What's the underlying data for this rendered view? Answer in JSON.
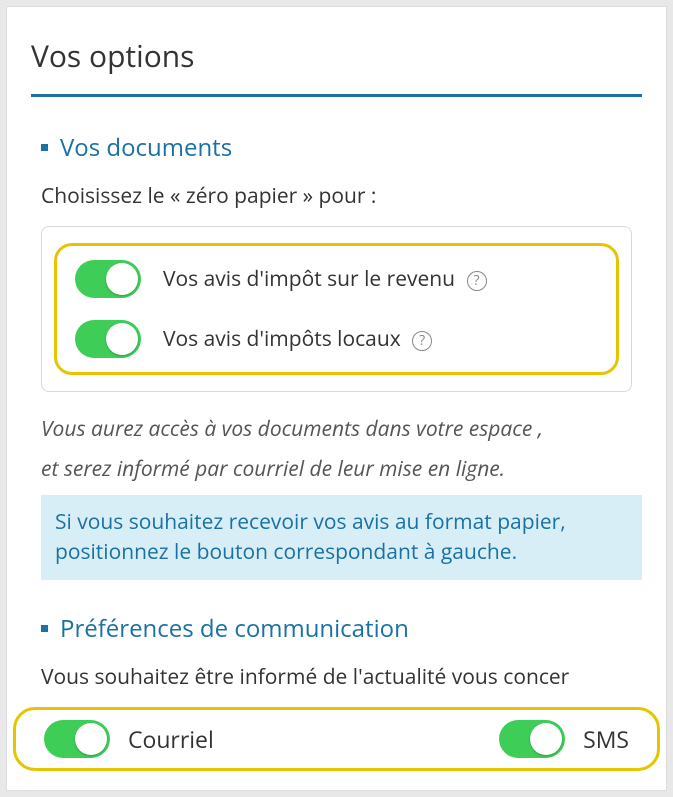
{
  "header": {
    "title": "Vos options"
  },
  "documents": {
    "heading": "Vos documents",
    "subheading": "Choisissez le « zéro papier » pour :",
    "toggles": [
      {
        "label": "Vos avis d'impôt sur le revenu",
        "on": true
      },
      {
        "label": "Vos avis d'impôts locaux",
        "on": true
      }
    ],
    "note_line1": "Vous aurez accès à vos documents dans votre espace ,",
    "note_line2": "et serez informé par courriel de leur mise en ligne.",
    "banner": "Si vous souhaitez recevoir vos avis au format papier, positionnez le bouton correspondant à gauche."
  },
  "communication": {
    "heading": "Préférences de communication",
    "subheading": "Vous souhaitez être informé de l'actualité vous concer",
    "toggles": [
      {
        "label": "Courriel",
        "on": true
      },
      {
        "label": "SMS",
        "on": true
      }
    ]
  }
}
